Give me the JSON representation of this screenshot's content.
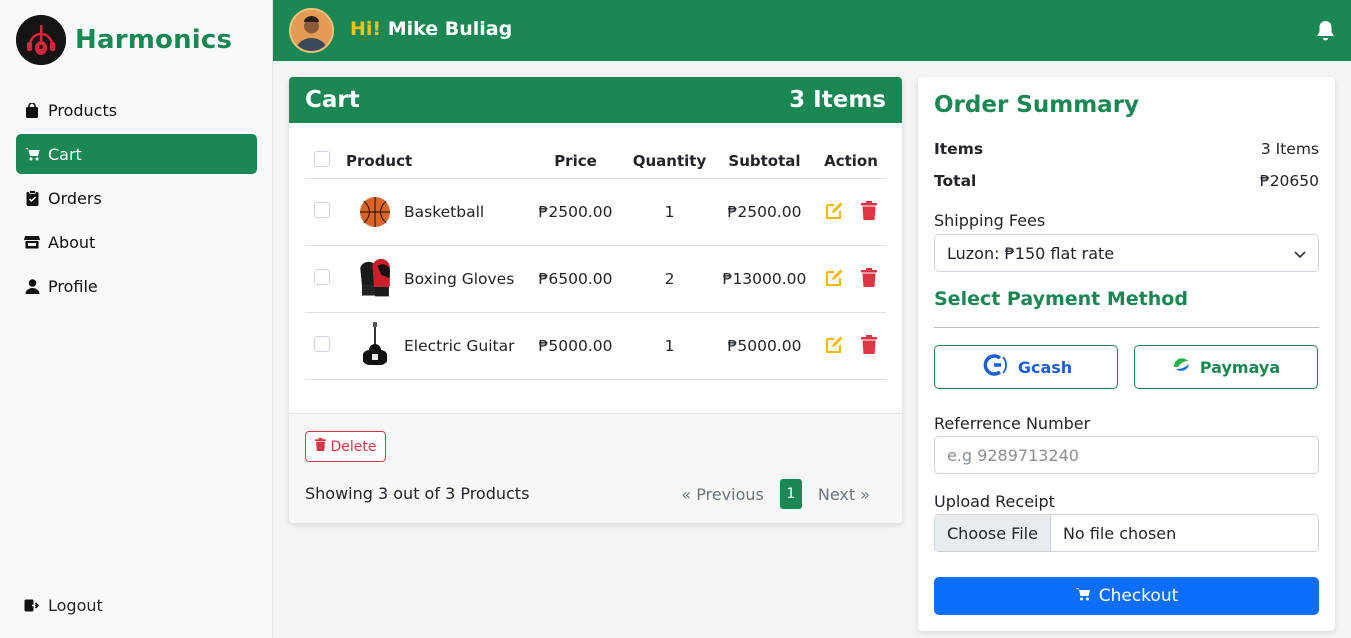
{
  "brand": {
    "name": "Harmonics"
  },
  "sidebar": {
    "items": [
      {
        "label": "Products",
        "icon": "bag-icon",
        "active": false
      },
      {
        "label": "Cart",
        "icon": "cart-icon",
        "active": true
      },
      {
        "label": "Orders",
        "icon": "clipboard-icon",
        "active": false
      },
      {
        "label": "About",
        "icon": "store-icon",
        "active": false
      },
      {
        "label": "Profile",
        "icon": "person-icon",
        "active": false
      }
    ],
    "logout_label": "Logout"
  },
  "topbar": {
    "hi": "Hi!",
    "user_name": "Mike Buliag"
  },
  "cart": {
    "title": "Cart",
    "count_label": "3 Items",
    "columns": {
      "product": "Product",
      "price": "Price",
      "quantity": "Quantity",
      "subtotal": "Subtotal",
      "action": "Action"
    },
    "rows": [
      {
        "name": "Basketball",
        "price": "₱2500.00",
        "qty": "1",
        "subtotal": "₱2500.00",
        "image": "basketball"
      },
      {
        "name": "Boxing Gloves",
        "price": "₱6500.00",
        "qty": "2",
        "subtotal": "₱13000.00",
        "image": "boxing-gloves"
      },
      {
        "name": "Electric Guitar",
        "price": "₱5000.00",
        "qty": "1",
        "subtotal": "₱5000.00",
        "image": "electric-guitar"
      }
    ],
    "delete_label": "Delete",
    "showing": "Showing 3 out of 3 Products",
    "pagination": {
      "previous": "« Previous",
      "current": "1",
      "next": "Next »"
    }
  },
  "summary": {
    "title": "Order Summary",
    "items_label": "Items",
    "items_value": "3 Items",
    "total_label": "Total",
    "total_value": "₱20650",
    "shipping_label": "Shipping Fees",
    "shipping_selected": "Luzon: ₱150 flat rate",
    "payment_title": "Select Payment Method",
    "gcash_label": "Gcash",
    "paymaya_label": "Paymaya",
    "reference_label": "Referrence Number",
    "reference_placeholder": "e.g 9289713240",
    "upload_label": "Upload Receipt",
    "choose_file": "Choose File",
    "no_file": "No file chosen",
    "checkout_label": "Checkout"
  },
  "colors": {
    "primary": "#1b8754",
    "accent": "#ffc107",
    "danger": "#dc3545",
    "blue": "#0d6efd"
  }
}
